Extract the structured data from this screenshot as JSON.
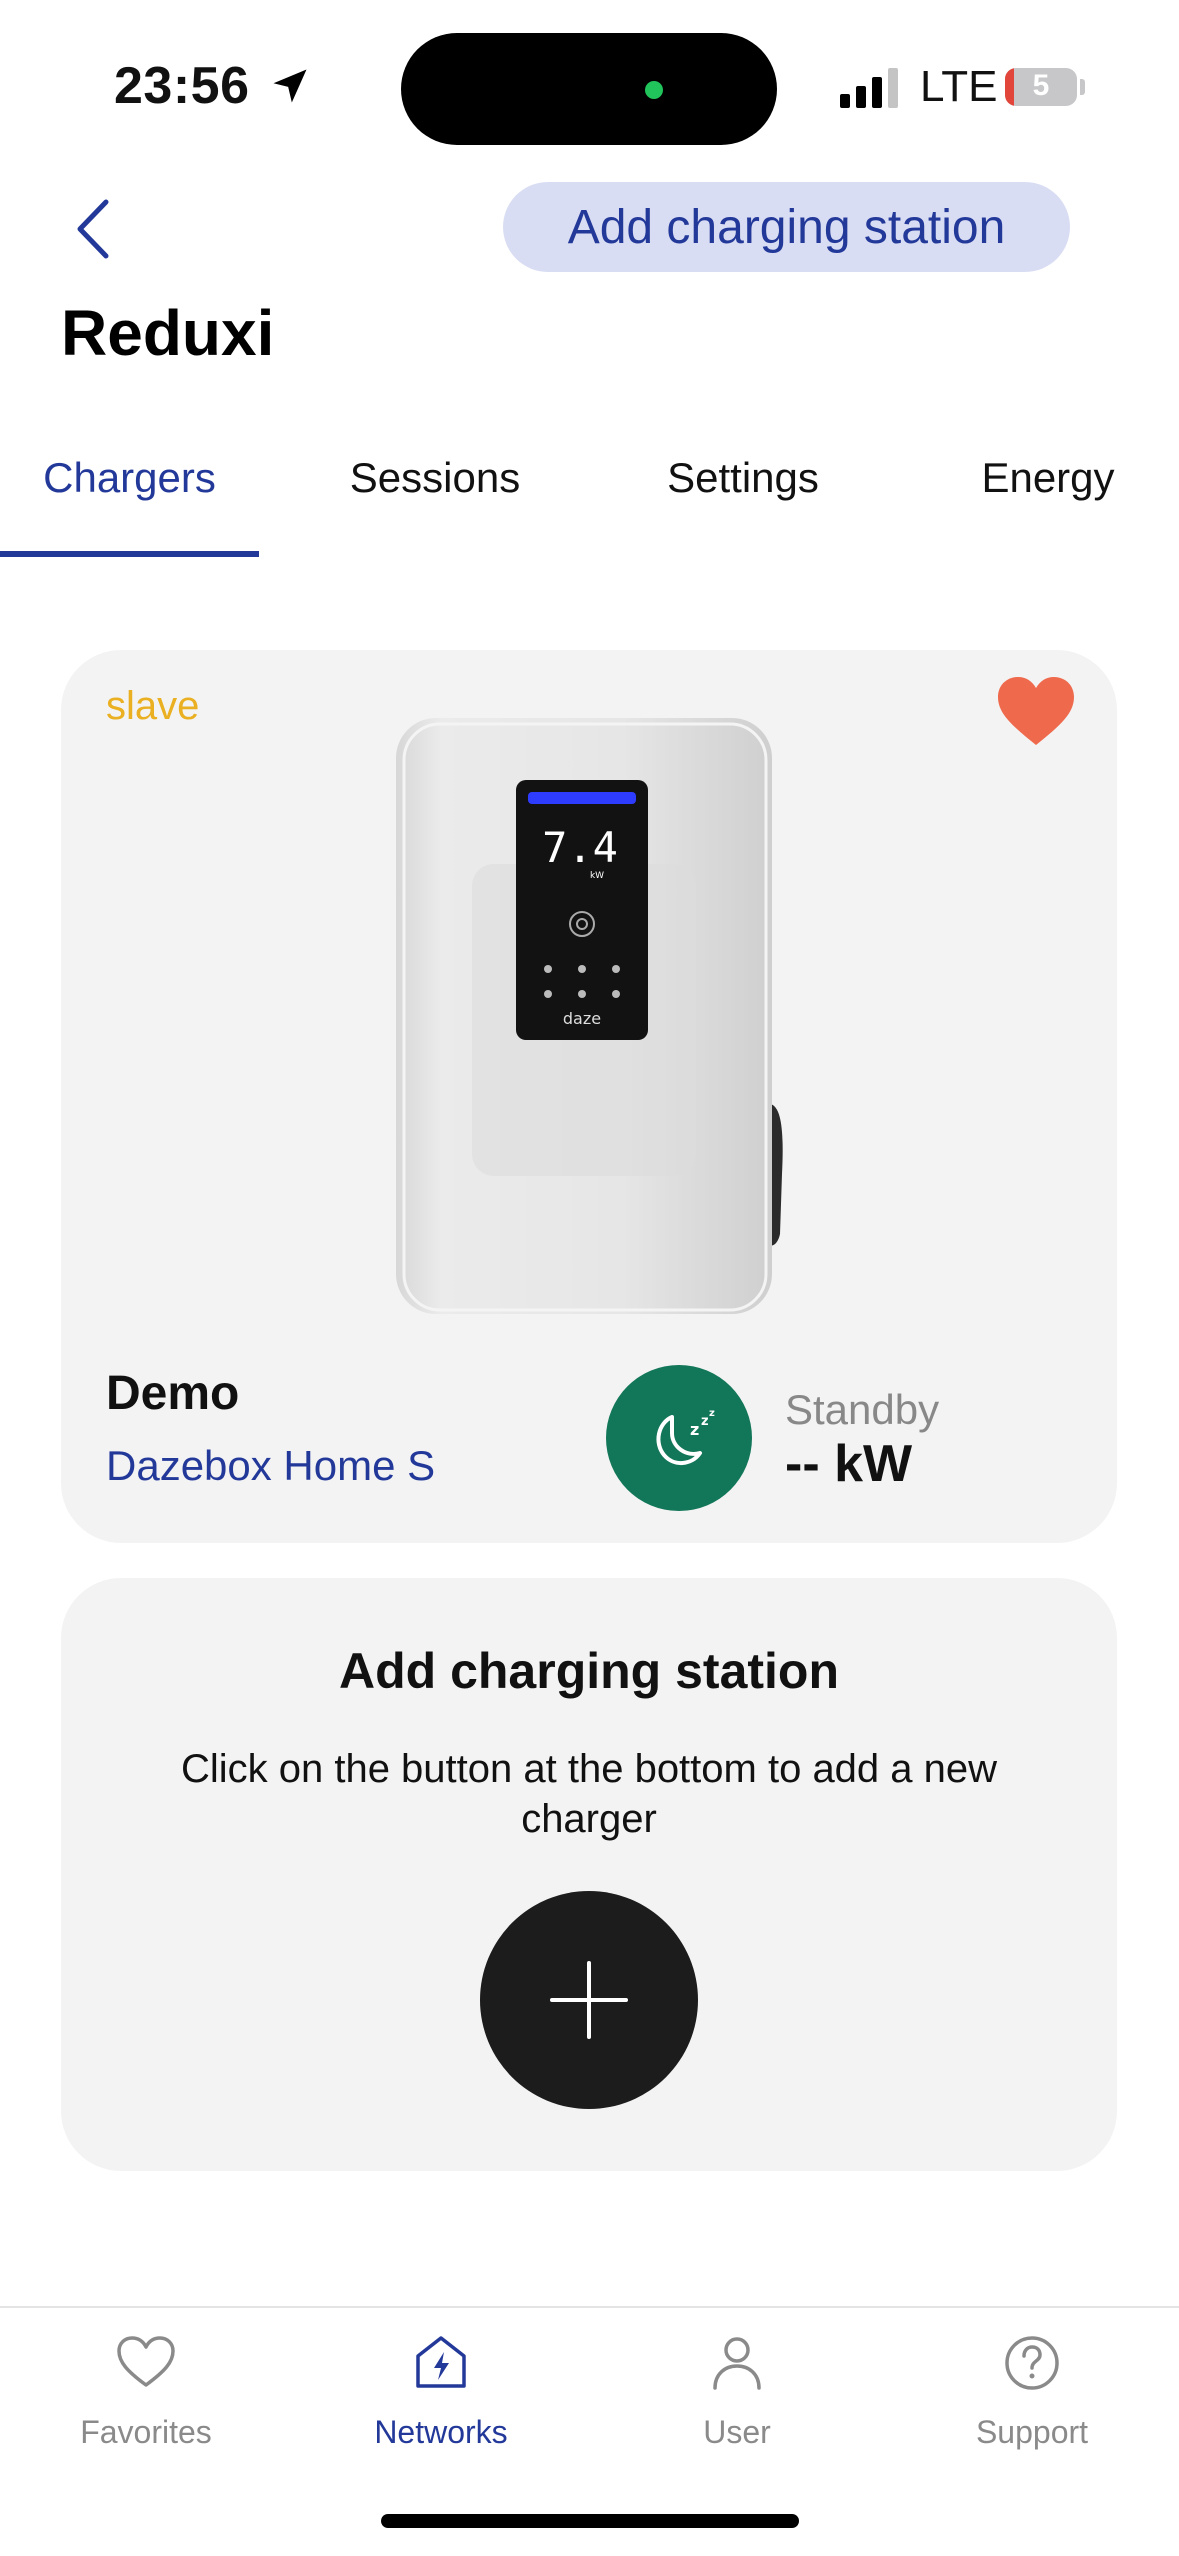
{
  "status_bar": {
    "time": "23:56",
    "network": "LTE",
    "battery": "5",
    "battery_level": 0.05,
    "icons": [
      "location-arrow-icon",
      "signal-icon",
      "battery-icon"
    ]
  },
  "header": {
    "back_icon": "chevron-left-icon",
    "add_button_label": "Add charging station",
    "title": "Reduxi"
  },
  "tabs": [
    {
      "label": "Chargers",
      "active": true
    },
    {
      "label": "Sessions",
      "active": false
    },
    {
      "label": "Settings",
      "active": false
    },
    {
      "label": "Energy",
      "active": false
    }
  ],
  "charger_card": {
    "role_badge": "slave",
    "favorite_icon": "heart-icon",
    "name": "Demo",
    "model": "Dazebox Home S",
    "status_icon": "sleep-moon-icon",
    "status": "Standby",
    "power": "-- kW",
    "device_display": {
      "power": "7.4",
      "unit": "kW",
      "brand": "daze"
    }
  },
  "add_card": {
    "title": "Add charging station",
    "description": "Click on the button at the bottom to add a new charger",
    "button_icon": "plus-icon"
  },
  "bottom_nav": [
    {
      "label": "Favorites",
      "icon": "heart-outline-icon",
      "active": false
    },
    {
      "label": "Networks",
      "icon": "bolt-house-icon",
      "active": true
    },
    {
      "label": "User",
      "icon": "user-icon",
      "active": false
    },
    {
      "label": "Support",
      "icon": "question-circle-icon",
      "active": false
    }
  ],
  "colors": {
    "accent": "#23399a",
    "pill_bg": "#d9ddf3",
    "card_bg": "#f3f3f3",
    "slave_badge": "#eab022",
    "heart": "#ef6a4c",
    "status_green": "#127658"
  }
}
